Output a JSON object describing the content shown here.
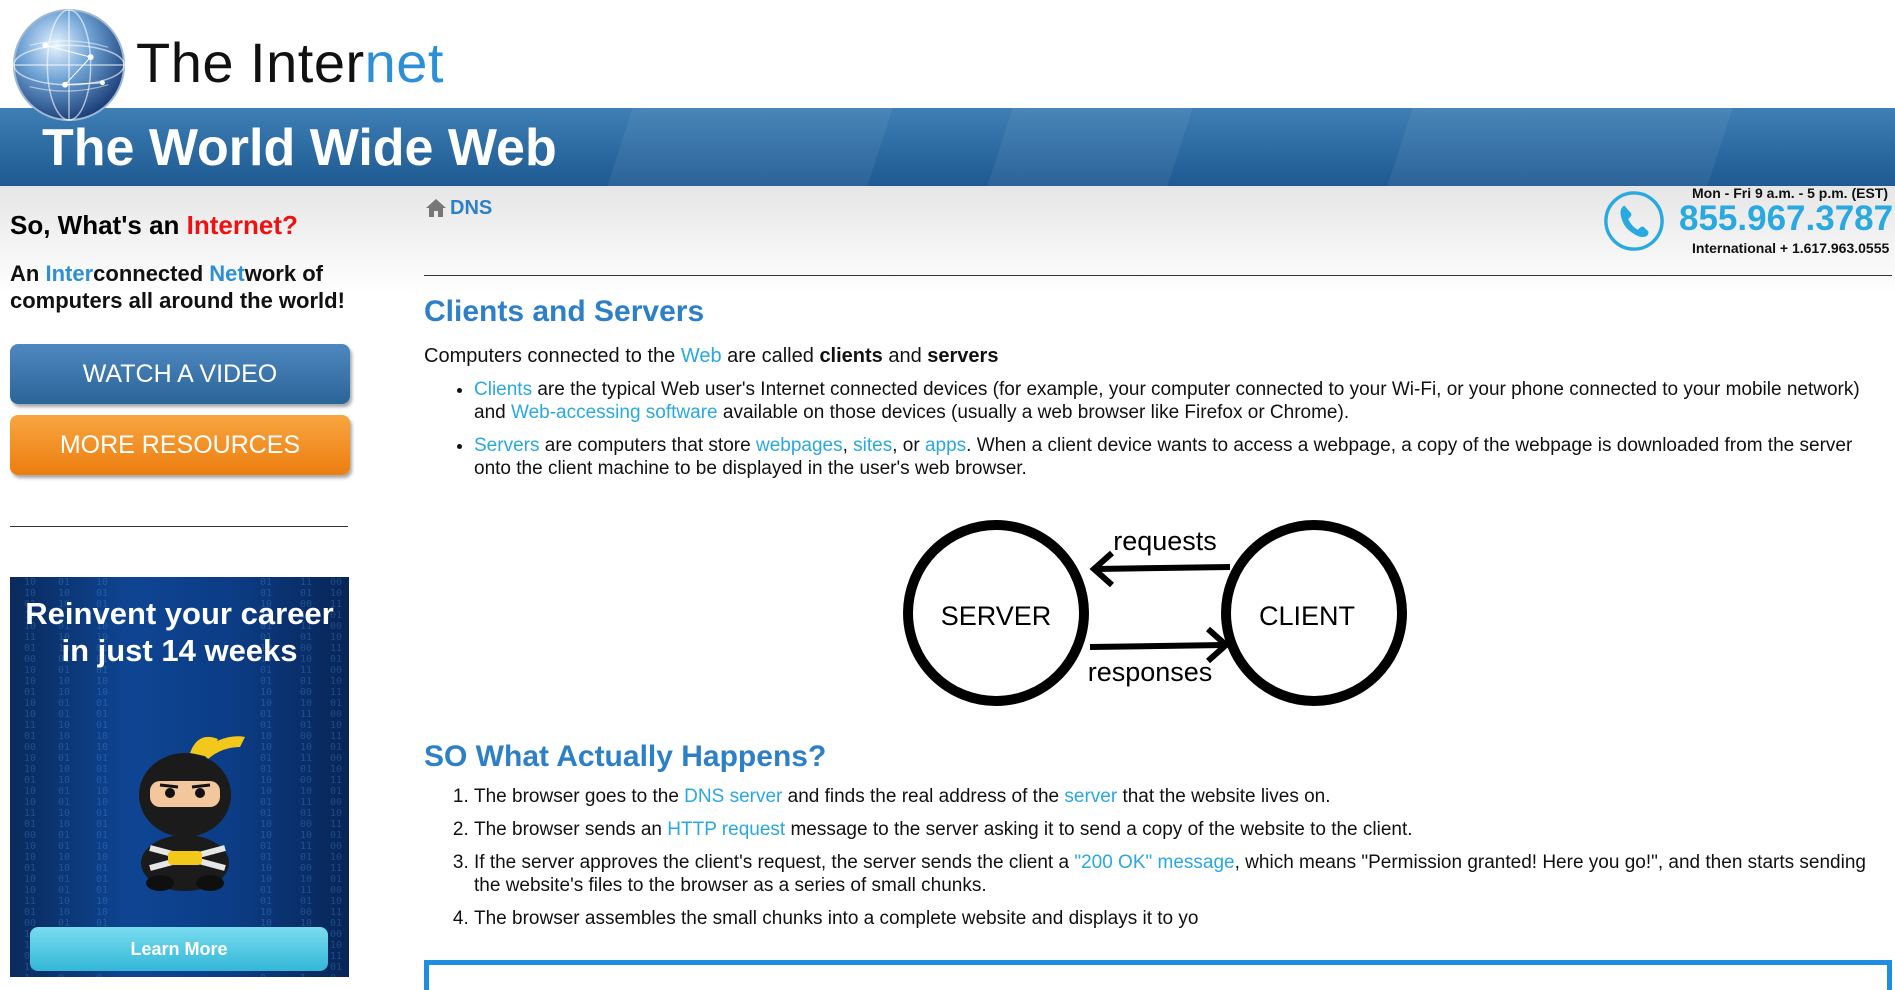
{
  "header": {
    "logo_part1": "The Inter",
    "logo_part2": "net",
    "banner_title": "The World Wide Web"
  },
  "sidebar": {
    "heading_part1": "So, What's an ",
    "heading_part2": "Internet?",
    "desc_an": "An ",
    "desc_inter": "Inter",
    "desc_connected": "connected ",
    "desc_net": "Net",
    "desc_rest": "work of computers all around the world!",
    "watch_video": "WATCH A VIDEO",
    "more_resources": "MORE RESOURCES",
    "ad": {
      "title": "Reinvent your career in just 14 weeks",
      "button": "Learn More"
    }
  },
  "breadcrumb": {
    "label": "DNS"
  },
  "contact": {
    "hours": "Mon - Fri 9 a.m. - 5 p.m. (EST)",
    "phone": "855.967.3787",
    "international": "International + 1.617.963.0555"
  },
  "section1": {
    "title": "Clients and Servers",
    "intro_1": "Computers connected to the ",
    "intro_link": "Web",
    "intro_2": " are called ",
    "intro_bold1": "clients",
    "intro_3": " and ",
    "intro_bold2": "servers",
    "bullet1": {
      "link1": "Clients",
      "text1": " are the typical Web user's Internet connected devices (for example, your computer connected to your Wi-Fi, or your phone connected to your mobile network) and ",
      "link2": "Web-accessing software",
      "text2": " available on those devices (usually a web browser like Firefox or Chrome)."
    },
    "bullet2": {
      "link1": "Servers",
      "text1": " are computers that store ",
      "link2": "webpages",
      "sep1": ", ",
      "link3": "sites",
      "sep2": ", or ",
      "link4": "apps",
      "text2": ". When a client device wants to access a webpage, a copy of the webpage is downloaded from the server onto the client machine to be displayed in the user's web browser."
    }
  },
  "diagram": {
    "server": "SERVER",
    "client": "CLIENT",
    "requests": "requests",
    "responses": "responses"
  },
  "section2": {
    "title": "SO What Actually Happens?",
    "step1": {
      "t1": "The browser goes to the ",
      "l1": "DNS server",
      "t2": " and finds the real address of the ",
      "l2": "server",
      "t3": " that the website lives on."
    },
    "step2": {
      "t1": "The browser sends an ",
      "l1": "HTTP request",
      "t2": " message to the server asking it to send a copy of the website to the client."
    },
    "step3": {
      "t1": "If the server approves the client's request, the server sends the client a ",
      "l1": "\"200 OK\" message",
      "t2": ", which means \"Permission granted! Here you go!\", and then starts sending the website's files to the browser as a series of small chunks."
    },
    "step4": {
      "t1": "The browser assembles the small chunks into a complete website and displays it to yo"
    }
  },
  "colors": {
    "link": "#2aa8e0",
    "heading_blue": "#2d7fc7",
    "banner": "#2c6aa2",
    "red": "#ee1111",
    "orange": "#ec7d10"
  },
  "icons": [
    "globe-icon",
    "home-icon",
    "phone-icon",
    "ninja-icon"
  ]
}
